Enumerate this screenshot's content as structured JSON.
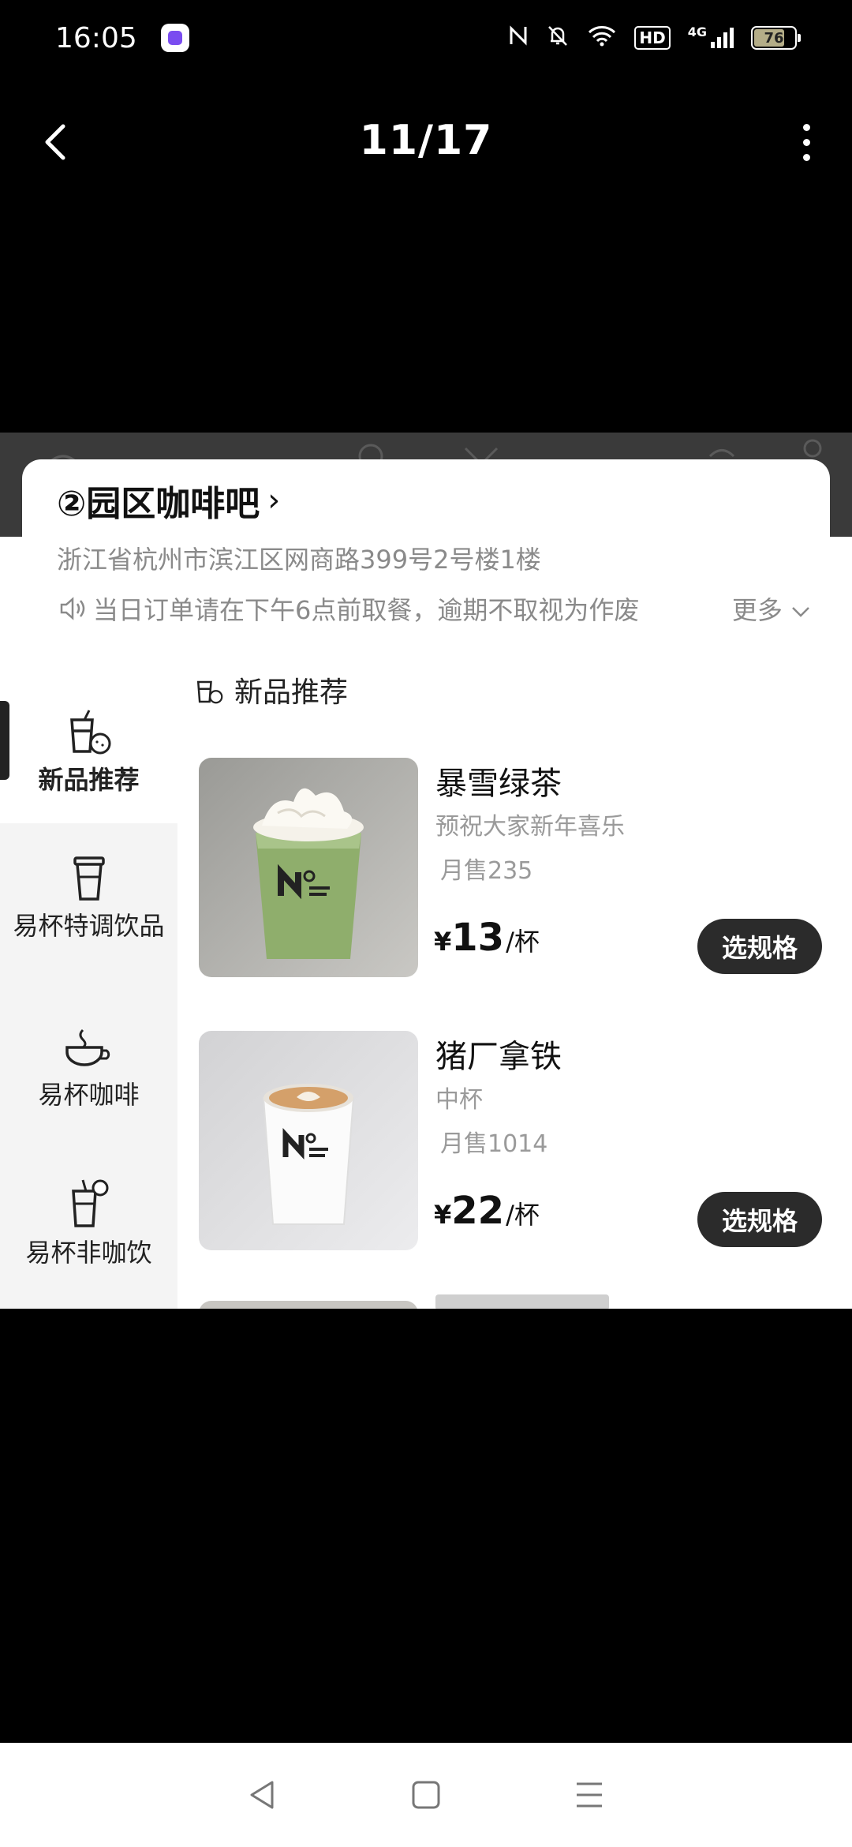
{
  "status_bar": {
    "time": "16:05",
    "battery": "76",
    "network": "4G",
    "hd": "HD"
  },
  "viewer": {
    "page_counter": "11/17"
  },
  "shop": {
    "name": "②园区咖啡吧",
    "address": "浙江省杭州市滨江区网商路399号2号楼1楼",
    "notice": "当日订单请在下午6点前取餐，逾期不取视为作废",
    "more_label": "更多"
  },
  "categories": [
    {
      "label": "新品推荐",
      "active": true
    },
    {
      "label": "易杯特调饮品",
      "active": false
    },
    {
      "label": "易杯咖啡",
      "active": false
    },
    {
      "label": "易杯非咖饮",
      "active": false
    }
  ],
  "section": {
    "title": "新品推荐"
  },
  "products": [
    {
      "name": "暴雪绿茶",
      "description": "预祝大家新年喜乐",
      "sales": "月售235",
      "currency": "¥",
      "price": "13",
      "unit": "/杯",
      "button": "选规格"
    },
    {
      "name": "猪厂拿铁",
      "description": "中杯",
      "sales": "月售1014",
      "currency": "¥",
      "price": "22",
      "unit": "/杯",
      "button": "选规格"
    }
  ],
  "colors": {
    "background": "#000000",
    "button_dark": "#2b2b2b",
    "muted_text": "#8a8a8a",
    "sidebar_bg": "#f4f4f4"
  }
}
